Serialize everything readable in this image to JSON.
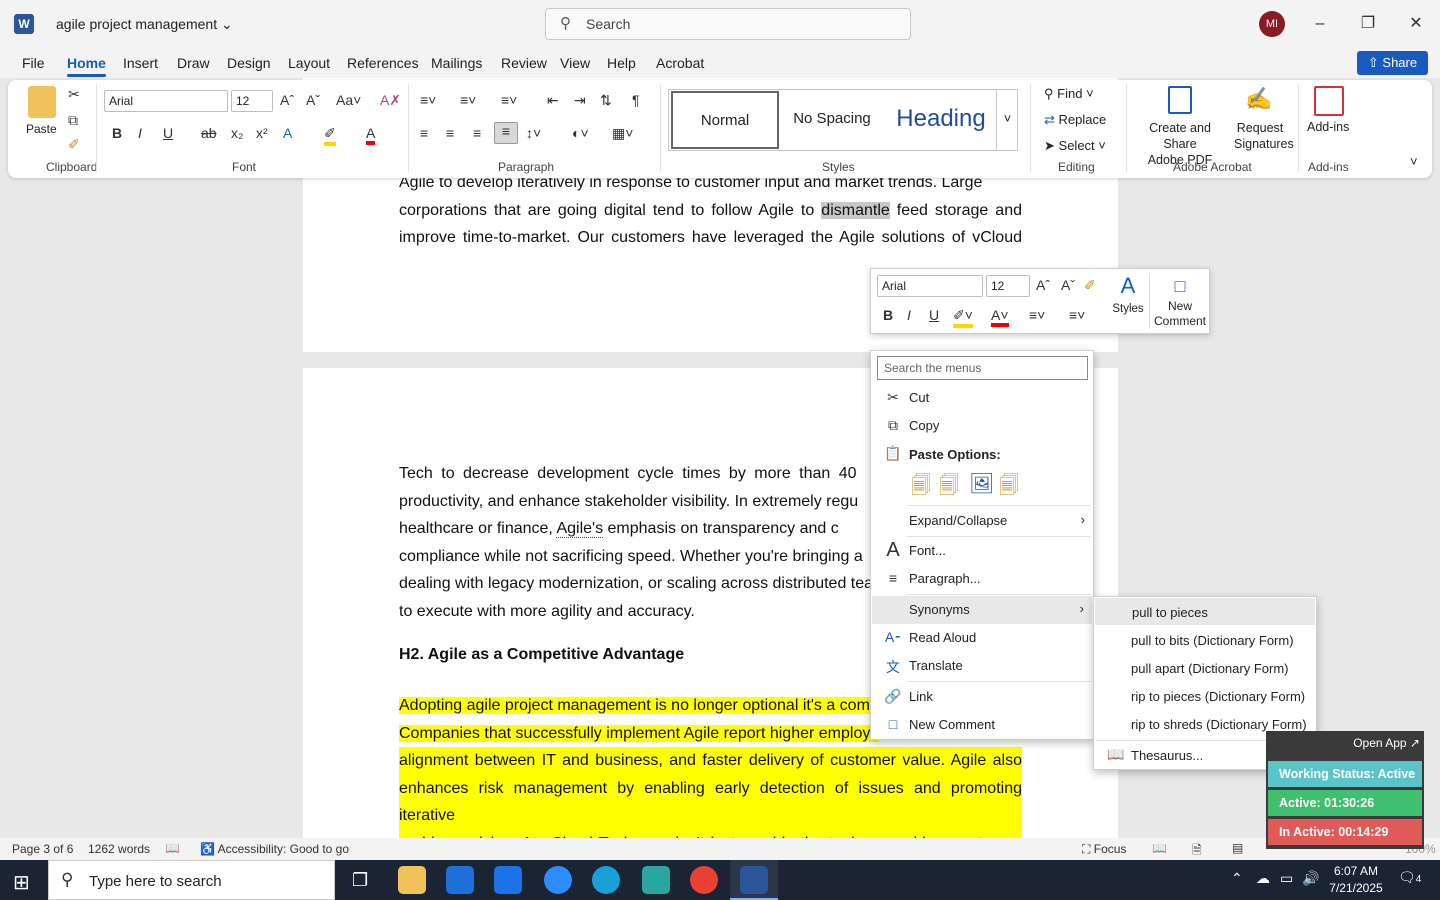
{
  "app": {
    "doc_title": "agile project management",
    "search_placeholder": "Search",
    "avatar_initials": "MI",
    "accent_color": "#185abd"
  },
  "tabs": [
    "File",
    "Home",
    "Insert",
    "Draw",
    "Design",
    "Layout",
    "References",
    "Mailings",
    "Review",
    "View",
    "Help",
    "Acrobat"
  ],
  "share_label": "Share",
  "ribbon": {
    "paste_label": "Paste",
    "font_name": "Arial",
    "font_size": "12",
    "styles": [
      "Normal",
      "No Spacing",
      "Heading"
    ],
    "find_label": "Find",
    "replace_label": "Replace",
    "select_label": "Select",
    "create_share_pdf": [
      "Create and Share",
      "Adobe PDF"
    ],
    "request_signatures": [
      "Request",
      "Signatures"
    ],
    "addins_label": "Add-ins",
    "groups": [
      "Clipboard",
      "Font",
      "Paragraph",
      "Styles",
      "Editing",
      "Adobe Acrobat",
      "Add-ins"
    ]
  },
  "document": {
    "top_lines": [
      "Agile to develop iteratively in response to customer input and market trends. Large",
      "corporations that are going digital tend to follow Agile to ",
      "dismantle",
      " feed storage and",
      "improve time-to-market. Our customers have leveraged the Agile solutions of vCloud"
    ],
    "para2_lines": [
      "Tech to decrease development cycle times by more than 40",
      "productivity, and enhance stakeholder visibility. In extremely regu",
      "healthcare or finance, ",
      "Agile's",
      " emphasis on transparency and c",
      "compliance while not sacrificing speed. Whether you're bringing a",
      "dealing with legacy modernization, or scaling across distributed tear",
      "to execute with more agility and accuracy."
    ],
    "heading": "H2. Agile as a Competitive Advantage",
    "hl_lines": [
      "Adopting agile project management is no longer optional it's a com",
      "Companies that successfully implement Agile report higher employe",
      "alignment between IT and business, and faster delivery of customer value. Agile also",
      "enhances risk management by enabling early detection of issues and promoting iterative",
      "problem-solving. At vCloud Tech, we don't just provide the tools we guide your teams"
    ]
  },
  "mini_toolbar": {
    "font_name": "Arial",
    "font_size": "12",
    "styles_label": "Styles",
    "new_comment": [
      "New",
      "Comment"
    ]
  },
  "context_menu": {
    "search_placeholder": "Search the menus",
    "cut": "Cut",
    "copy": "Copy",
    "paste_options": "Paste Options:",
    "expand_collapse": "Expand/Collapse",
    "font": "Font...",
    "paragraph": "Paragraph...",
    "synonyms": "Synonyms",
    "read_aloud": "Read Aloud",
    "translate": "Translate",
    "link": "Link",
    "new_comment": "New Comment"
  },
  "synonyms_menu": [
    "pull to pieces",
    "pull to bits (Dictionary Form)",
    "pull apart (Dictionary Form)",
    "rip to pieces (Dictionary Form)",
    "rip to shreds (Dictionary Form)"
  ],
  "thesaurus": "Thesaurus...",
  "tracker": {
    "open_app": "Open App ↗",
    "status": "Working Status: Active",
    "active": "Active: 01:30:26",
    "inactive": "In Active: 00:14:29",
    "status_color": "#5bc4c9",
    "active_color": "#3fbf6f",
    "inactive_color": "#e05a57"
  },
  "statusbar": {
    "page": "Page 3 of 6",
    "words": "1262 words",
    "accessibility": "Accessibility: Good to go",
    "focus": "Focus",
    "zoom": "100%"
  },
  "taskbar": {
    "search_placeholder": "Type here to search",
    "time": "6:07 AM",
    "date": "7/21/2025",
    "notifications": "4"
  }
}
